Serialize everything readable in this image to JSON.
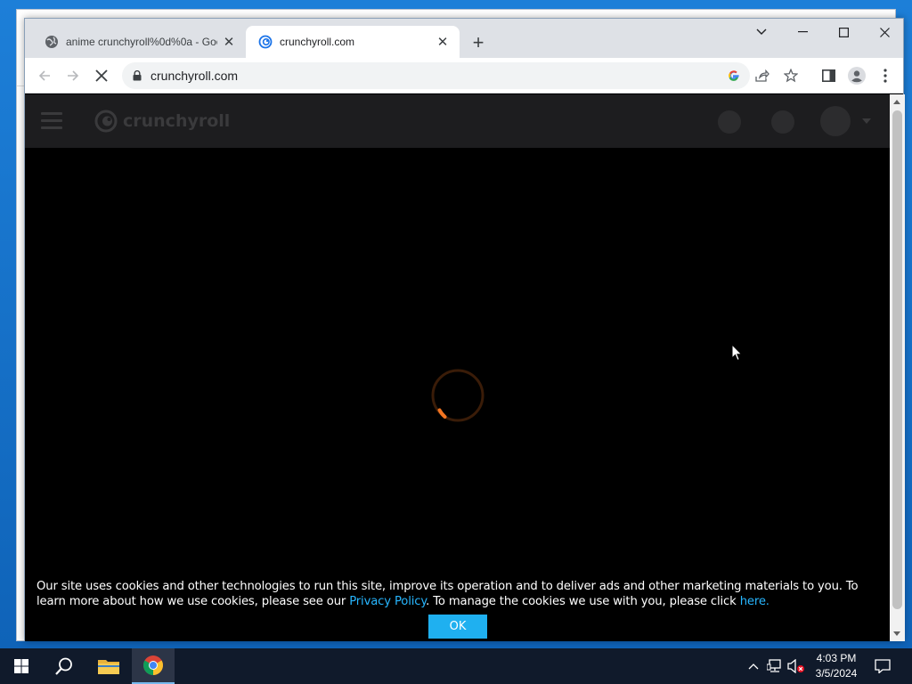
{
  "browser": {
    "tabs": [
      {
        "title": "anime crunchyroll%0d%0a - Goo",
        "favicon": "globe-icon",
        "active": false
      },
      {
        "title": "crunchyroll.com",
        "favicon": "crunchyroll-icon",
        "active": true
      }
    ],
    "url": "crunchyroll.com",
    "loading": true
  },
  "page": {
    "logo_text": "crunchyroll",
    "cookie_notice": {
      "text_before": "Our site uses cookies and other technologies to run this site, improve its operation and to deliver ads and other marketing materials to you. To learn more about how we use cookies, please see our ",
      "privacy_link": "Privacy Policy",
      "text_middle": ". To manage the cookies we use with you, please click ",
      "here_link": "here.",
      "ok_label": "OK"
    }
  },
  "colors": {
    "accent_link": "#27b6ff",
    "ok_button": "#1fb0f0",
    "spinner": "#f47521"
  },
  "taskbar": {
    "time": "4:03 PM",
    "date": "3/5/2024"
  }
}
